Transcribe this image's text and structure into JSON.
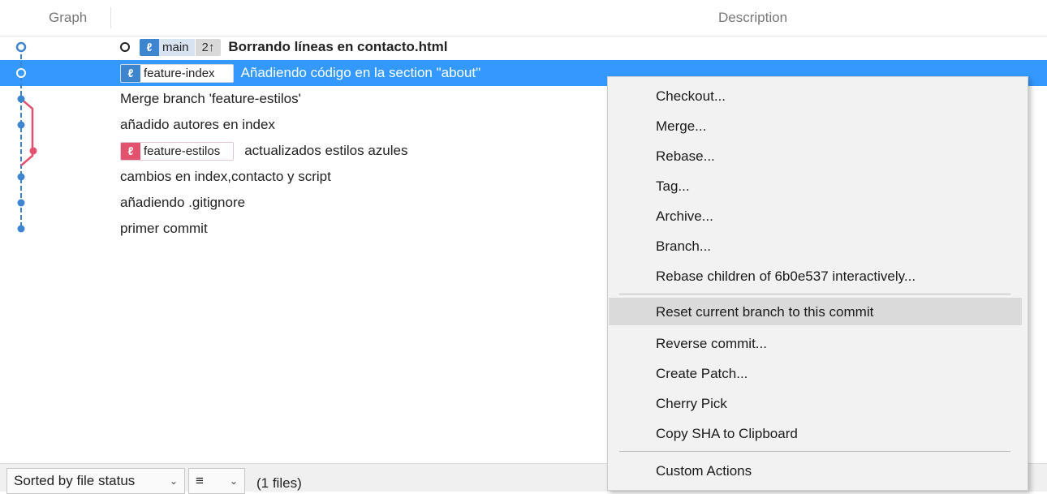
{
  "header": {
    "graph_label": "Graph",
    "description_label": "Description"
  },
  "commits": [
    {
      "refs": [
        {
          "kind": "main",
          "name": "main",
          "ahead": "2↑"
        }
      ],
      "message": "Borrando líneas en contacto.html",
      "head": true
    },
    {
      "refs": [
        {
          "kind": "feature-index",
          "name": "feature-index"
        }
      ],
      "message": "Añadiendo código en la section \"about\"",
      "selected": true
    },
    {
      "refs": [],
      "message": "Merge branch 'feature-estilos'"
    },
    {
      "refs": [],
      "message": "añadido autores en index"
    },
    {
      "refs": [
        {
          "kind": "feature-estilos",
          "name": "feature-estilos"
        }
      ],
      "message": "actualizados estilos azules"
    },
    {
      "refs": [],
      "message": "cambios en index,contacto y script"
    },
    {
      "refs": [],
      "message": "añadiendo .gitignore"
    },
    {
      "refs": [],
      "message": "primer commit"
    }
  ],
  "branch_icon_glyph": "ℓ",
  "colors": {
    "main_branch": "#3e85cf",
    "feature_estilos": "#e2526e",
    "selection": "#3399ff",
    "menu_highlight": "#dadada"
  },
  "context_menu": {
    "items": [
      "Checkout...",
      "Merge...",
      "Rebase...",
      "Tag...",
      "Archive...",
      "Branch...",
      "Rebase children of 6b0e537 interactively...",
      "Reset current branch to this commit",
      "Reverse commit...",
      "Create Patch...",
      "Cherry Pick",
      "Copy SHA to Clipboard",
      "Custom Actions"
    ],
    "highlighted": "Reset current branch to this commit"
  },
  "footer": {
    "sort_label": "Sorted by file status",
    "view_icon": "list-icon",
    "files_count": "(1 files)"
  }
}
